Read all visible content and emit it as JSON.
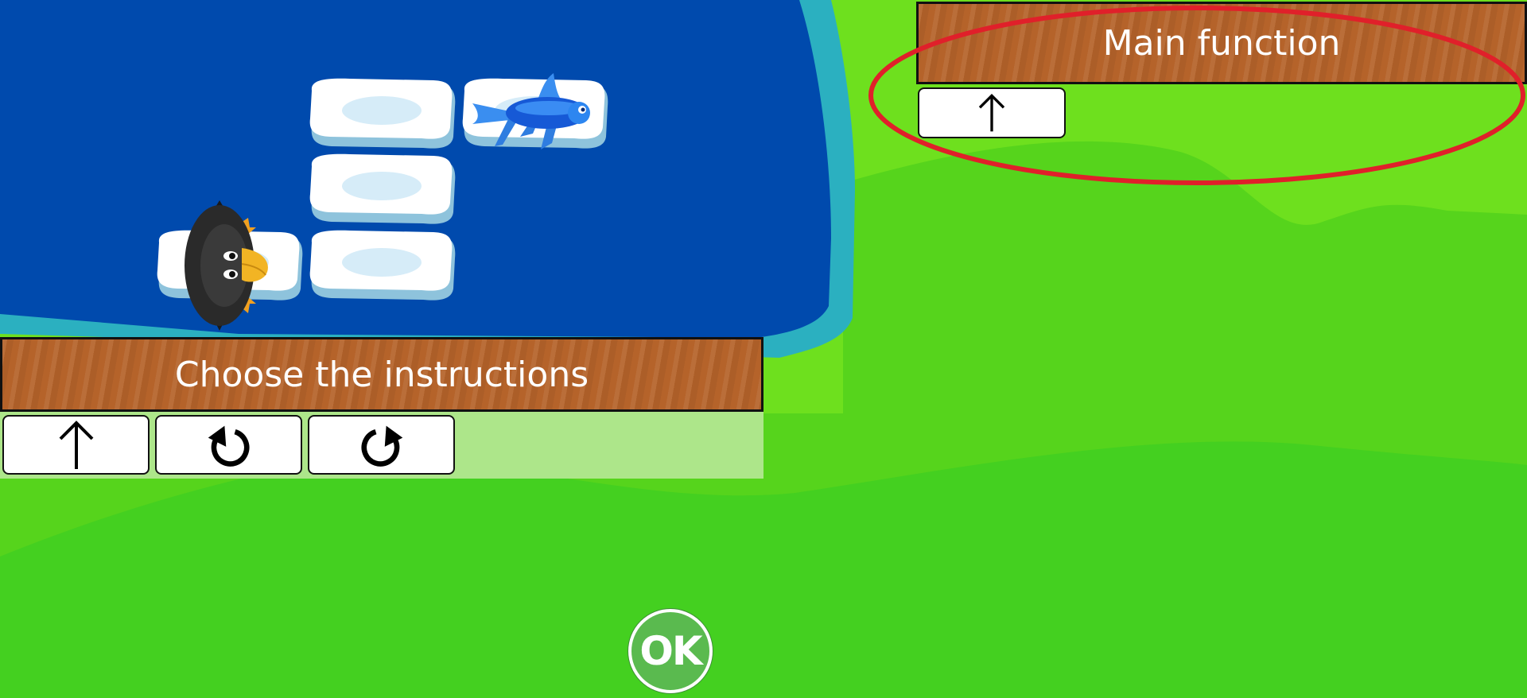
{
  "game": {
    "board": {
      "penguin_icon": "penguin-sprite",
      "fish_icon": "fish-sprite",
      "ice_floe_icon": "ice-floe"
    },
    "main_function": {
      "title": "Main function",
      "instructions": [
        {
          "icon": "arrow-up-icon",
          "action": "forward"
        }
      ]
    },
    "instructions_panel": {
      "title": "Choose the instructions",
      "instructions": [
        {
          "icon": "arrow-up-icon",
          "action": "forward"
        },
        {
          "icon": "rotate-left-icon",
          "action": "turn left"
        },
        {
          "icon": "rotate-right-icon",
          "action": "turn right"
        }
      ]
    },
    "ok_button": {
      "label": "OK"
    },
    "colors": {
      "water": "#004aad",
      "shore": "#2bb0c0",
      "grass_light": "#6ee01e",
      "grass_dark": "#44d020",
      "banner_wood": "#b5632a",
      "annotation_red": "#e0202a",
      "ok_green": "#5aba4f"
    }
  }
}
